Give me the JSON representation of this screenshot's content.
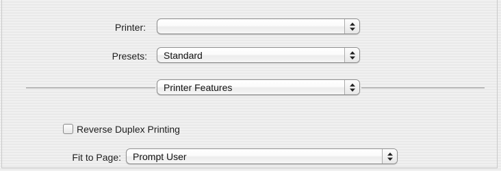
{
  "printer": {
    "label": "Printer:",
    "value": ""
  },
  "presets": {
    "label": "Presets:",
    "value": "Standard"
  },
  "panel": {
    "value": "Printer Features"
  },
  "reverse_duplex": {
    "label": "Reverse Duplex Printing",
    "checked": false
  },
  "fit_to_page": {
    "label": "Fit to Page:",
    "value": "Prompt User"
  },
  "icons": {
    "popup_arrows": "up-down-arrows-icon"
  }
}
